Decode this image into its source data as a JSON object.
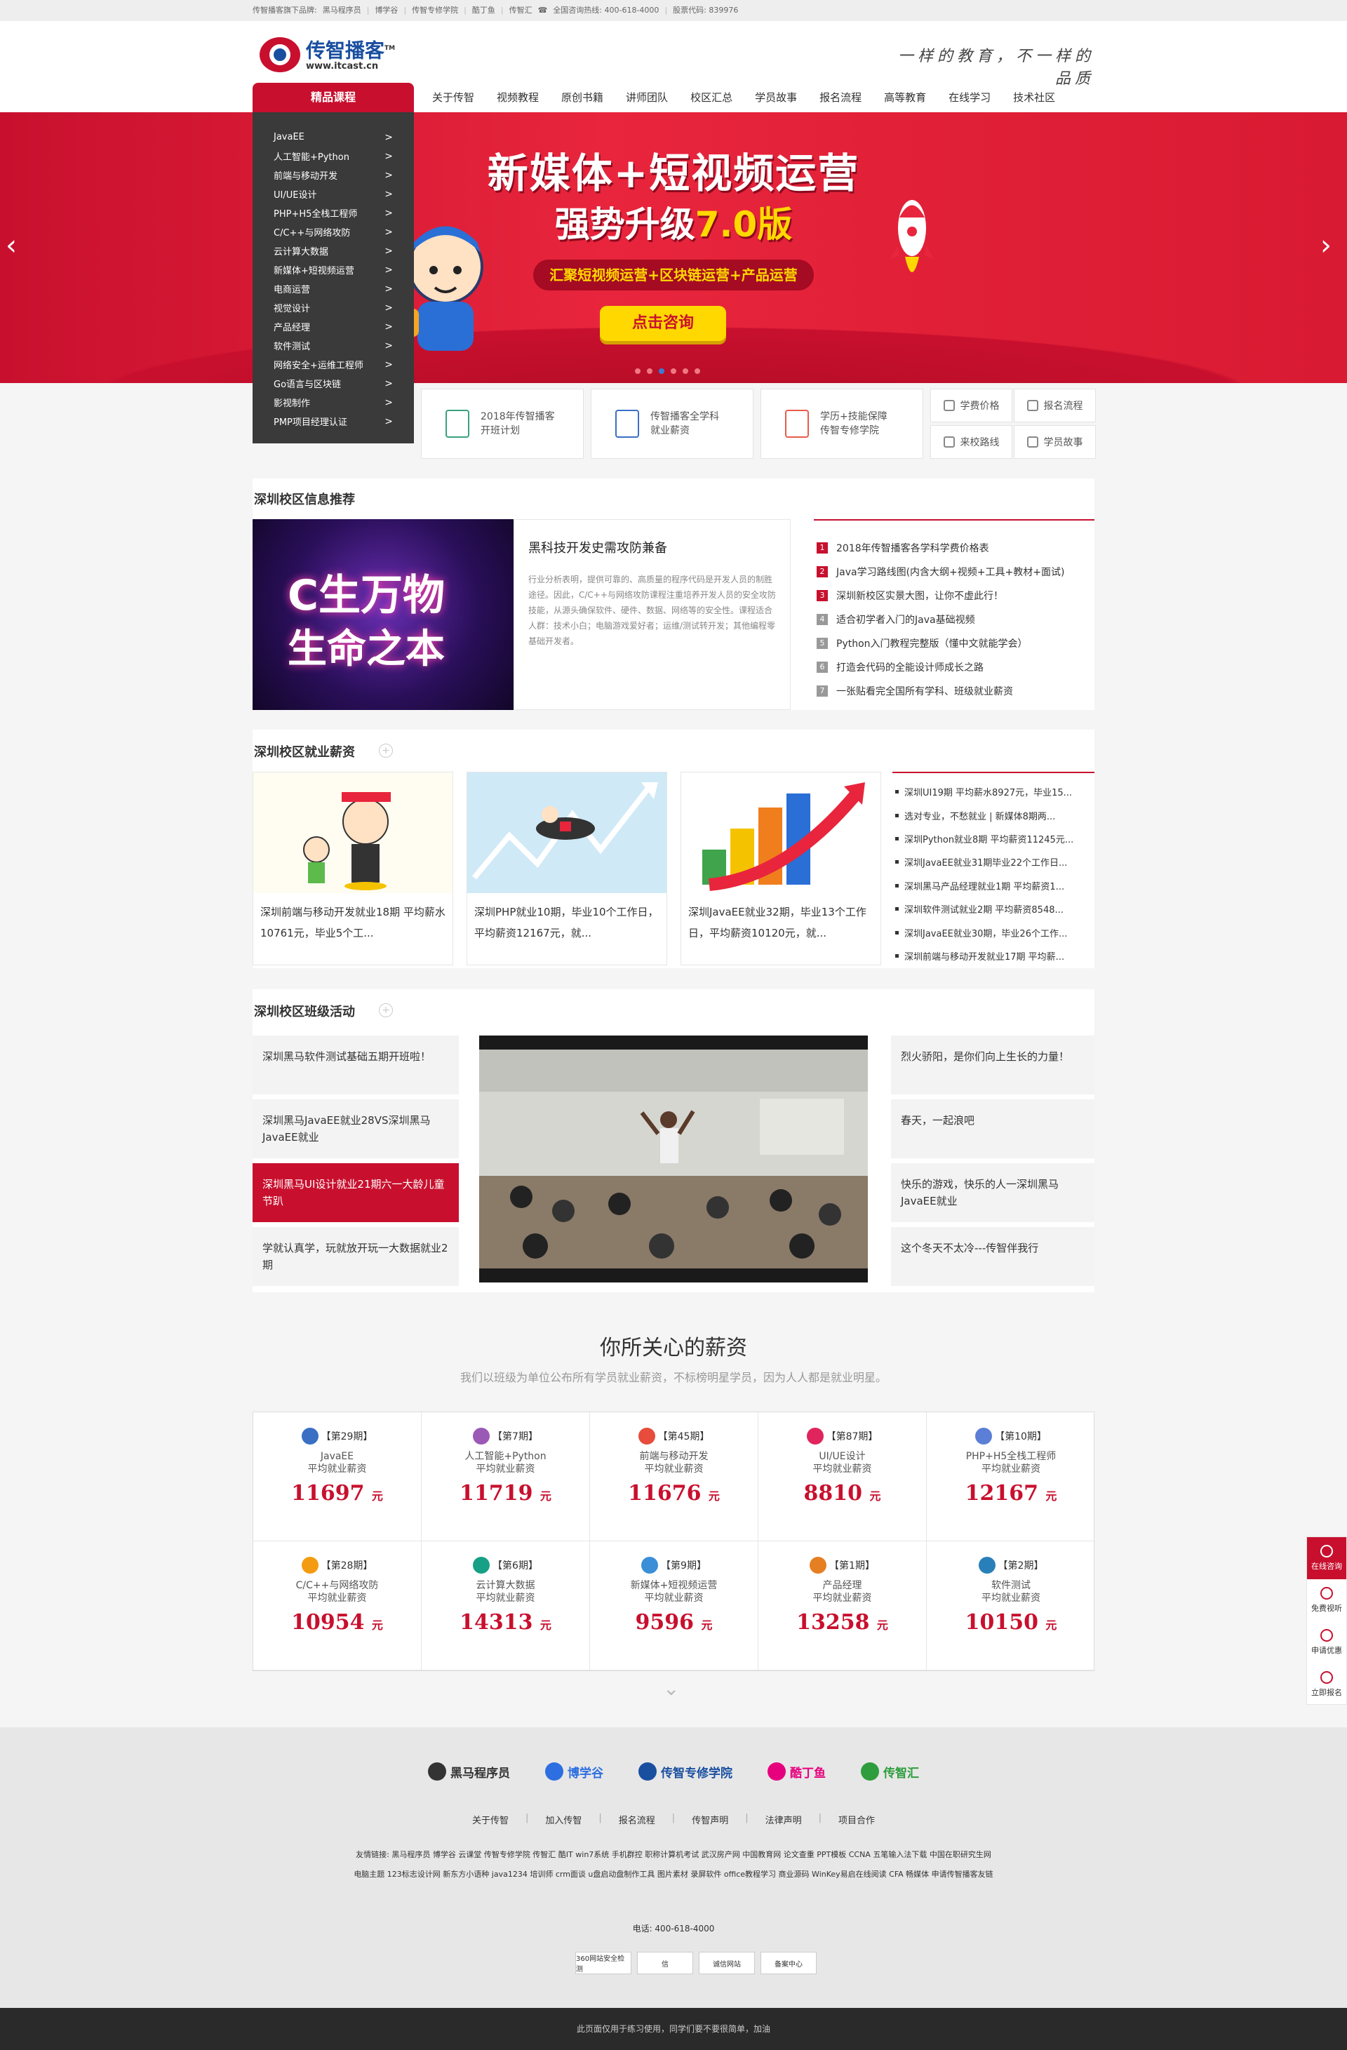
{
  "topbar": {
    "brand_label": "传智播客旗下品牌:",
    "links": [
      "黑马程序员",
      "博学谷",
      "传智专修学院",
      "酷丁鱼",
      "传智汇"
    ],
    "hotline": "全国咨询热线: 400-618-4000",
    "stock": "股票代码: 839976"
  },
  "header": {
    "logo_cn": "传智播客",
    "logo_tm": "TM",
    "logo_url": "www.itcast.cn",
    "slogan": "一样的教育，不一样的品质"
  },
  "nav": {
    "course_label": "精品课程",
    "items": [
      "关于传智",
      "视频教程",
      "原创书籍",
      "讲师团队",
      "校区汇总",
      "学员故事",
      "报名流程",
      "高等教育",
      "在线学习",
      "技术社区"
    ]
  },
  "sidemenu": [
    "JavaEE",
    "人工智能+Python",
    "前端与移动开发",
    "UI/UE设计",
    "PHP+H5全栈工程师",
    "C/C++与网络攻防",
    "云计算大数据",
    "新媒体+短视频运营",
    "电商运营",
    "视觉设计",
    "产品经理",
    "软件测试",
    "网络安全+运维工程师",
    "Go语言与区块链",
    "影视制作",
    "PMP项目经理认证"
  ],
  "banner": {
    "title": "新媒体+短视频运营",
    "sub_prefix": "强势升级",
    "sub_version": "7.0版",
    "tag": "汇聚短视频运营+区块链运营+产品运营",
    "button": "点击咨询",
    "dot_count": 6,
    "active_dot": 2
  },
  "quick": {
    "boxes": [
      {
        "line1": "2018年传智播客",
        "line2": "开班计划",
        "color": "#3aa17e"
      },
      {
        "line1": "传智播客全学科",
        "line2": "就业薪资",
        "color": "#3a6fc4"
      },
      {
        "line1": "学历+技能保障",
        "line2": "传智专修学院",
        "color": "#e85c4a"
      }
    ],
    "small": [
      "学费价格",
      "报名流程",
      "来校路线",
      "学员故事"
    ]
  },
  "info": {
    "title": "深圳校区信息推荐",
    "img_text1": "C生万物",
    "img_text2": "生命之本",
    "article_title": "黑科技开发史需攻防兼备",
    "article_body": "行业分析表明，提供可靠的、高质量的程序代码是开发人员的制胜途径。因此，C/C++与网络攻防课程注重培养开发人员的安全攻防技能，从源头确保软件、硬件、数据、网络等的安全性。课程适合人群：技术小白；电脑游戏爱好者；运维/测试转开发；其他编程零基础开发者。",
    "list": [
      "2018年传智播客各学科学费价格表",
      "Java学习路线图(内含大纲+视频+工具+教材+面试)",
      "深圳新校区实景大图，让你不虚此行！",
      "适合初学者入门的Java基础视频",
      "Python入门教程完整版（懂中文就能学会）",
      "打造会代码的全能设计师成长之路",
      "一张贴看完全国所有学科、班级就业薪资"
    ]
  },
  "employment": {
    "title": "深圳校区就业薪资",
    "cards": [
      "深圳前端与移动开发就业18期  平均薪水10761元，毕业5个工...",
      "深圳PHP就业10期，毕业10个工作日，平均薪资12167元，就...",
      "深圳JavaEE就业32期，毕业13个工作日，平均薪资10120元，就..."
    ],
    "list": [
      "深圳UI19期  平均薪水8927元，毕业15...",
      "选对专业，不愁就业 | 新媒体8期两...",
      "深圳Python就业8期 平均薪资11245元...",
      "深圳JavaEE就业31期毕业22个工作日...",
      "深圳黑马产品经理就业1期  平均薪资1...",
      "深圳软件测试就业2期  平均薪资8548...",
      "深圳JavaEE就业30期，毕业26个工作...",
      "深圳前端与移动开发就业17期  平均薪..."
    ]
  },
  "activity": {
    "title": "深圳校区班级活动",
    "left": [
      "深圳黑马软件测试基础五期开班啦！",
      "深圳黑马JavaEE就业28VS深圳黑马JavaEE就业",
      "深圳黑马UI设计就业21期六一大龄儿童节趴",
      "学就认真学，玩就放开玩一大数据就业2期"
    ],
    "right": [
      "烈火骄阳，是你们向上生长的力量！",
      "春天，一起浪吧",
      "快乐的游戏，快乐的人一深圳黑马JavaEE就业",
      "这个冬天不太冷---传智伴我行"
    ]
  },
  "salary": {
    "title": "你所关心的薪资",
    "subtitle": "我们以班级为单位公布所有学员就业薪资，不标榜明星学员，因为人人都是就业明星。",
    "unit": "元",
    "suffix": "平均就业薪资",
    "items": [
      {
        "period": "【第29期】",
        "name": "JavaEE",
        "value": "11697",
        "color": "#3a6fc4"
      },
      {
        "period": "【第7期】",
        "name": "人工智能+Python",
        "value": "11719",
        "color": "#9b59b6"
      },
      {
        "period": "【第45期】",
        "name": "前端与移动开发",
        "value": "11676",
        "color": "#e74c3c"
      },
      {
        "period": "【第87期】",
        "name": "UI/UE设计",
        "value": "8810",
        "color": "#e0245e"
      },
      {
        "period": "【第10期】",
        "name": "PHP+H5全栈工程师",
        "value": "12167",
        "color": "#5b7fd6"
      },
      {
        "period": "【第28期】",
        "name": "C/C++与网络攻防",
        "value": "10954",
        "color": "#f39c12"
      },
      {
        "period": "【第6期】",
        "name": "云计算大数据",
        "value": "14313",
        "color": "#16a085"
      },
      {
        "period": "【第9期】",
        "name": "新媒体+短视频运营",
        "value": "9596",
        "color": "#3a8fd6"
      },
      {
        "period": "【第1期】",
        "name": "产品经理",
        "value": "13258",
        "color": "#e67e22"
      },
      {
        "period": "【第2期】",
        "name": "软件测试",
        "value": "10150",
        "color": "#2980b9"
      }
    ]
  },
  "float": [
    "在线咨询",
    "免费视听",
    "申请优惠",
    "立即报名"
  ],
  "footer": {
    "partners": [
      {
        "name": "黑马程序员",
        "color": "#333"
      },
      {
        "name": "博学谷",
        "color": "#2d6fe0"
      },
      {
        "name": "传智专修学院",
        "color": "#1a4fa0"
      },
      {
        "name": "酷丁鱼",
        "color": "#e6007e"
      },
      {
        "name": "传智汇",
        "color": "#2e9d3e"
      }
    ],
    "links": [
      "关于传智",
      "加入传智",
      "报名流程",
      "传智声明",
      "法律声明",
      "项目合作"
    ],
    "friends": "友情链接: 黑马程序员 博学谷 云课堂 传智专修学院 传智汇 酷IT win7系统 手机群控 职称计算机考试 武汉房产网 中国教育网 论文查重 PPT模板 CCNA 五笔输入法下载 中国在职研究生网 电脑主题 123标志设计网 新东方小语种 java1234 培训师 crm面谈 u盘启动盘制作工具 图片素材 录屏软件 office教程学习 商业源码 WinKey易启在线阅读 CFA 畅媒体 申请传智播客友链",
    "phone": "电话: 400-618-4000",
    "badges": [
      "360网站安全检测",
      "信",
      "诚信网站",
      "备案中心"
    ],
    "bottom": "此页面仅用于练习使用，同学们要不要很简单，加油"
  }
}
